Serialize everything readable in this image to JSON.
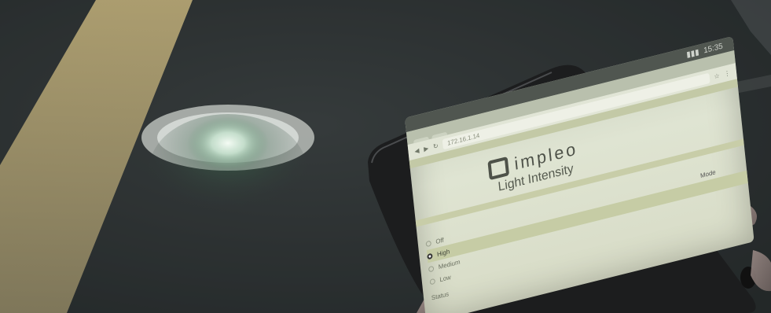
{
  "device": {
    "status_bar": {
      "time": "15:35"
    },
    "browser": {
      "tabs": [
        "",
        ""
      ],
      "url": "172.16.1.14"
    },
    "page": {
      "logo_text": "impleo",
      "title": "Light Intensity",
      "mode_label": "Mode",
      "options": [
        {
          "label": "Off",
          "selected": false
        },
        {
          "label": "High",
          "selected": true
        },
        {
          "label": "Medium",
          "selected": false
        },
        {
          "label": "Low",
          "selected": false
        }
      ],
      "status_label": "Status"
    }
  },
  "colors": {
    "road": "#2f3435",
    "lane_line": "#b9a978",
    "light_glow": "#e8f3ea",
    "tablet_body": "#1c1d1e",
    "screen_bg": "#d9ddc9"
  }
}
